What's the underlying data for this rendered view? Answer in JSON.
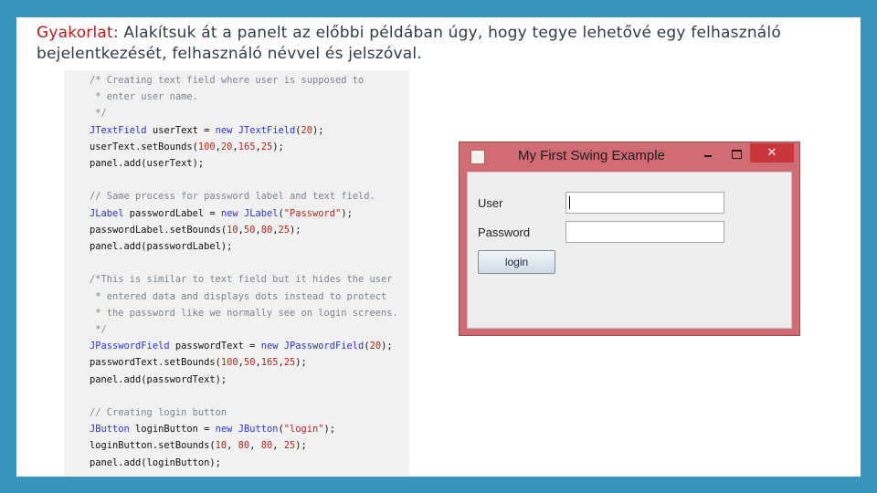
{
  "slide": {
    "heading_keyword": "Gyakorlat",
    "heading_text": ": Alakítsuk át a panelt az előbbi példában úgy, hogy tegye lehetővé egy felhasználó bejelentkezését, felhasználó névvel és jelszóval."
  },
  "code": {
    "lines": [
      [
        {
          "t": "/* Creating text field where user is supposed to",
          "c": "com"
        }
      ],
      [
        {
          "t": " * enter user name.",
          "c": "com"
        }
      ],
      [
        {
          "t": " */",
          "c": "com"
        }
      ],
      [
        {
          "t": "JTextField",
          "c": "typ"
        },
        {
          "t": " userText = "
        },
        {
          "t": "new",
          "c": "kw"
        },
        {
          "t": " "
        },
        {
          "t": "JTextField",
          "c": "typ"
        },
        {
          "t": "("
        },
        {
          "t": "20",
          "c": "num"
        },
        {
          "t": ");"
        }
      ],
      [
        {
          "t": "userText.setBounds("
        },
        {
          "t": "100",
          "c": "num"
        },
        {
          "t": ","
        },
        {
          "t": "20",
          "c": "num"
        },
        {
          "t": ","
        },
        {
          "t": "165",
          "c": "num"
        },
        {
          "t": ","
        },
        {
          "t": "25",
          "c": "num"
        },
        {
          "t": ");"
        }
      ],
      [
        {
          "t": "panel.add(userText);"
        }
      ],
      [],
      [
        {
          "t": "// Same process for password label and text field.",
          "c": "com"
        }
      ],
      [
        {
          "t": "JLabel",
          "c": "typ"
        },
        {
          "t": " passwordLabel = "
        },
        {
          "t": "new",
          "c": "kw"
        },
        {
          "t": " "
        },
        {
          "t": "JLabel",
          "c": "typ"
        },
        {
          "t": "("
        },
        {
          "t": "\"Password\"",
          "c": "str"
        },
        {
          "t": ");"
        }
      ],
      [
        {
          "t": "passwordLabel.setBounds("
        },
        {
          "t": "10",
          "c": "num"
        },
        {
          "t": ","
        },
        {
          "t": "50",
          "c": "num"
        },
        {
          "t": ","
        },
        {
          "t": "80",
          "c": "num"
        },
        {
          "t": ","
        },
        {
          "t": "25",
          "c": "num"
        },
        {
          "t": ");"
        }
      ],
      [
        {
          "t": "panel.add(passwordLabel);"
        }
      ],
      [],
      [
        {
          "t": "/*This is similar to text field but it hides the user",
          "c": "com"
        }
      ],
      [
        {
          "t": " * entered data and displays dots instead to protect",
          "c": "com"
        }
      ],
      [
        {
          "t": " * the password like we normally see on login screens.",
          "c": "com"
        }
      ],
      [
        {
          "t": " */",
          "c": "com"
        }
      ],
      [
        {
          "t": "JPasswordField",
          "c": "typ"
        },
        {
          "t": " passwordText = "
        },
        {
          "t": "new",
          "c": "kw"
        },
        {
          "t": " "
        },
        {
          "t": "JPasswordField",
          "c": "typ"
        },
        {
          "t": "("
        },
        {
          "t": "20",
          "c": "num"
        },
        {
          "t": ");"
        }
      ],
      [
        {
          "t": "passwordText.setBounds("
        },
        {
          "t": "100",
          "c": "num"
        },
        {
          "t": ","
        },
        {
          "t": "50",
          "c": "num"
        },
        {
          "t": ","
        },
        {
          "t": "165",
          "c": "num"
        },
        {
          "t": ","
        },
        {
          "t": "25",
          "c": "num"
        },
        {
          "t": ");"
        }
      ],
      [
        {
          "t": "panel.add(passwordText);"
        }
      ],
      [],
      [
        {
          "t": "// Creating login button",
          "c": "com"
        }
      ],
      [
        {
          "t": "JButton",
          "c": "typ"
        },
        {
          "t": " loginButton = "
        },
        {
          "t": "new",
          "c": "kw"
        },
        {
          "t": " "
        },
        {
          "t": "JButton",
          "c": "typ"
        },
        {
          "t": "("
        },
        {
          "t": "\"login\"",
          "c": "str"
        },
        {
          "t": ");"
        }
      ],
      [
        {
          "t": "loginButton.setBounds("
        },
        {
          "t": "10",
          "c": "num"
        },
        {
          "t": ", "
        },
        {
          "t": "80",
          "c": "num"
        },
        {
          "t": ", "
        },
        {
          "t": "80",
          "c": "num"
        },
        {
          "t": ", "
        },
        {
          "t": "25",
          "c": "num"
        },
        {
          "t": ");"
        }
      ],
      [
        {
          "t": "panel.add(loginButton);"
        }
      ]
    ]
  },
  "window": {
    "title": "My First Swing Example",
    "icon": "java-cup-icon",
    "minimize_icon": "minimize-icon",
    "maximize_icon": "maximize-icon",
    "close_icon": "close-icon",
    "close_glyph": "✕",
    "user_label": "User",
    "password_label": "Password",
    "user_value": "",
    "password_value": "",
    "login_label": "login",
    "title_bar_color": "#d26c74",
    "close_color": "#c9353b"
  }
}
